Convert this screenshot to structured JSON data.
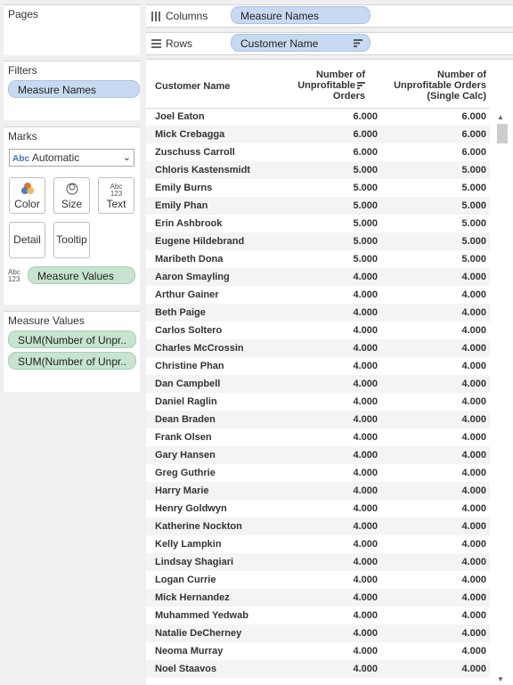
{
  "pages": {
    "title": "Pages"
  },
  "filters": {
    "title": "Filters",
    "pills": [
      "Measure Names"
    ]
  },
  "marks": {
    "title": "Marks",
    "mark_type": "Automatic",
    "mark_type_prefix": "Abc",
    "buttons": {
      "color": "Color",
      "size": "Size",
      "text": "Text",
      "detail": "Detail",
      "tooltip": "Tooltip"
    },
    "text_icon": [
      "Abc",
      "123"
    ],
    "values_pill": "Measure Values"
  },
  "measure_values": {
    "title": "Measure Values",
    "pills": [
      "SUM(Number of Unpr..",
      "SUM(Number of Unpr.."
    ]
  },
  "shelves": {
    "columns_label": "Columns",
    "columns_pill": "Measure Names",
    "rows_label": "Rows",
    "rows_pill": "Customer Name"
  },
  "table": {
    "headers": {
      "customer": "Customer Name",
      "col1": [
        "Number of",
        "Unprofitable",
        "Orders"
      ],
      "col2": [
        "Number of",
        "Unprofitable Orders",
        "(Single Calc)"
      ]
    },
    "rows": [
      [
        "Joel Eaton",
        "6.000",
        "6.000"
      ],
      [
        "Mick Crebagga",
        "6.000",
        "6.000"
      ],
      [
        "Zuschuss Carroll",
        "6.000",
        "6.000"
      ],
      [
        "Chloris Kastensmidt",
        "5.000",
        "5.000"
      ],
      [
        "Emily Burns",
        "5.000",
        "5.000"
      ],
      [
        "Emily Phan",
        "5.000",
        "5.000"
      ],
      [
        "Erin Ashbrook",
        "5.000",
        "5.000"
      ],
      [
        "Eugene Hildebrand",
        "5.000",
        "5.000"
      ],
      [
        "Maribeth Dona",
        "5.000",
        "5.000"
      ],
      [
        "Aaron Smayling",
        "4.000",
        "4.000"
      ],
      [
        "Arthur Gainer",
        "4.000",
        "4.000"
      ],
      [
        "Beth Paige",
        "4.000",
        "4.000"
      ],
      [
        "Carlos Soltero",
        "4.000",
        "4.000"
      ],
      [
        "Charles McCrossin",
        "4.000",
        "4.000"
      ],
      [
        "Christine Phan",
        "4.000",
        "4.000"
      ],
      [
        "Dan Campbell",
        "4.000",
        "4.000"
      ],
      [
        "Daniel Raglin",
        "4.000",
        "4.000"
      ],
      [
        "Dean Braden",
        "4.000",
        "4.000"
      ],
      [
        "Frank Olsen",
        "4.000",
        "4.000"
      ],
      [
        "Gary Hansen",
        "4.000",
        "4.000"
      ],
      [
        "Greg Guthrie",
        "4.000",
        "4.000"
      ],
      [
        "Harry Marie",
        "4.000",
        "4.000"
      ],
      [
        "Henry Goldwyn",
        "4.000",
        "4.000"
      ],
      [
        "Katherine Nockton",
        "4.000",
        "4.000"
      ],
      [
        "Kelly Lampkin",
        "4.000",
        "4.000"
      ],
      [
        "Lindsay Shagiari",
        "4.000",
        "4.000"
      ],
      [
        "Logan Currie",
        "4.000",
        "4.000"
      ],
      [
        "Mick Hernandez",
        "4.000",
        "4.000"
      ],
      [
        "Muhammed Yedwab",
        "4.000",
        "4.000"
      ],
      [
        "Natalie DeCherney",
        "4.000",
        "4.000"
      ],
      [
        "Neoma Murray",
        "4.000",
        "4.000"
      ],
      [
        "Noel Staavos",
        "4.000",
        "4.000"
      ]
    ]
  },
  "colors": {
    "blue_pill": "#c8daf2",
    "green_pill": "#c6e4cf",
    "stripe": "#f4f4f4"
  }
}
